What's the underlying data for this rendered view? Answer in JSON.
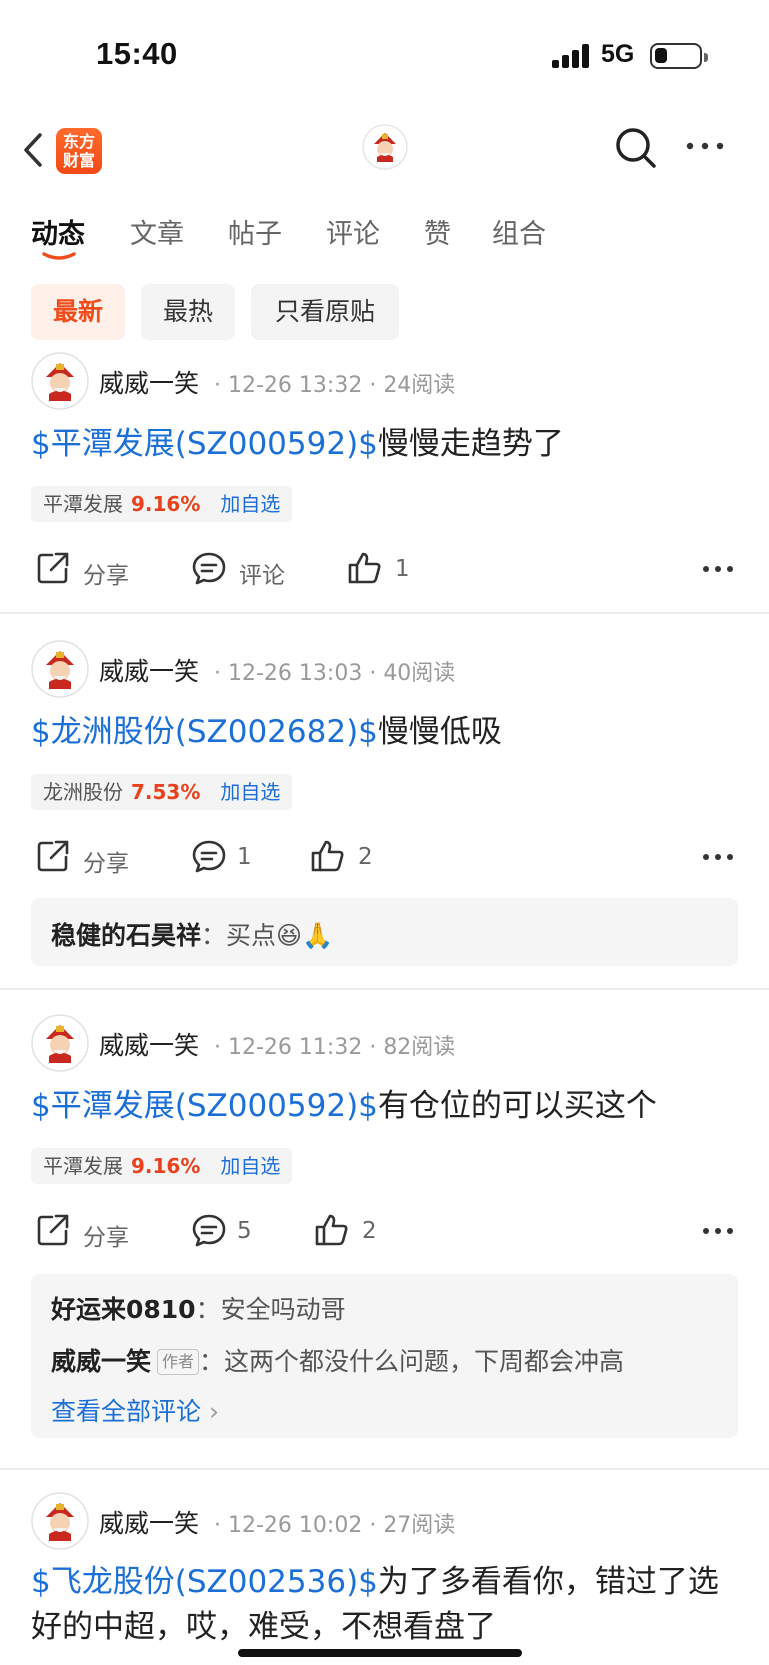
{
  "status": {
    "time": "15:40",
    "network": "5G"
  },
  "nav": {
    "logo_line1": "东方",
    "logo_line2": "财富"
  },
  "tabs": [
    {
      "label": "动态",
      "active": true
    },
    {
      "label": "文章",
      "active": false
    },
    {
      "label": "帖子",
      "active": false
    },
    {
      "label": "评论",
      "active": false
    },
    {
      "label": "赞",
      "active": false
    },
    {
      "label": "组合",
      "active": false
    }
  ],
  "filters": [
    {
      "label": "最新",
      "active": true
    },
    {
      "label": "最热",
      "active": false
    },
    {
      "label": "只看原贴",
      "active": false
    }
  ],
  "colors": {
    "accent": "#f04c1c",
    "link": "#1d6fd8",
    "up": "#e7421d"
  },
  "posts": [
    {
      "author": "威威一笑",
      "time": "12-26 13:32",
      "reads": "24阅读",
      "stock_link": "$平潭发展(SZ000592)$",
      "text": "慢慢走趋势了",
      "chip_name": "平潭发展",
      "chip_pct": "9.16%",
      "chip_add": "加自选",
      "share_label": "分享",
      "comment_label": "评论",
      "like_count": "1"
    },
    {
      "author": "威威一笑",
      "time": "12-26 13:03",
      "reads": "40阅读",
      "stock_link": "$龙洲股份(SZ002682)$",
      "text": "慢慢低吸",
      "chip_name": "龙洲股份",
      "chip_pct": "7.53%",
      "chip_add": "加自选",
      "share_label": "分享",
      "comment_label": "1",
      "like_count": "2",
      "comments": [
        {
          "user": "稳健的石昊祥",
          "text": "买点😆🙏"
        }
      ]
    },
    {
      "author": "威威一笑",
      "time": "12-26 11:32",
      "reads": "82阅读",
      "stock_link": "$平潭发展(SZ000592)$",
      "text": "有仓位的可以买这个",
      "chip_name": "平潭发展",
      "chip_pct": "9.16%",
      "chip_add": "加自选",
      "share_label": "分享",
      "comment_label": "5",
      "like_count": "2",
      "comments": [
        {
          "user": "好运来0810",
          "text": "安全吗动哥"
        },
        {
          "user": "威威一笑",
          "badge": "作者",
          "text": "这两个都没什么问题，下周都会冲高"
        }
      ],
      "view_all": "查看全部评论"
    },
    {
      "author": "威威一笑",
      "time": "12-26 10:02",
      "reads": "27阅读",
      "stock_link": "$飞龙股份(SZ002536)$",
      "text": "为了多看看你，错过了选好的中超，哎，难受，不想看盘了"
    }
  ]
}
